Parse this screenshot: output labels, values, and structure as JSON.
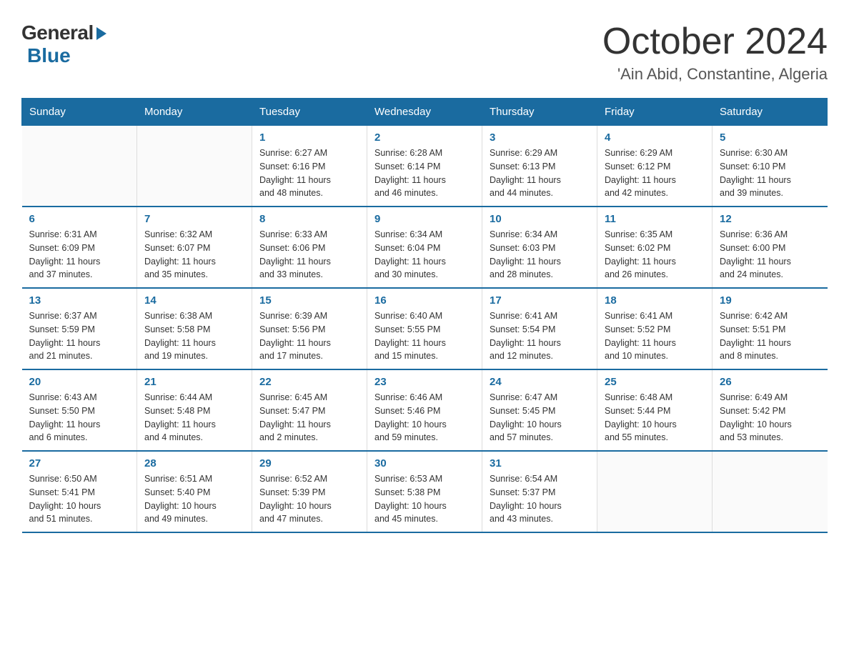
{
  "logo": {
    "general": "General",
    "blue": "Blue"
  },
  "title": "October 2024",
  "location": "'Ain Abid, Constantine, Algeria",
  "weekdays": [
    "Sunday",
    "Monday",
    "Tuesday",
    "Wednesday",
    "Thursday",
    "Friday",
    "Saturday"
  ],
  "weeks": [
    [
      {
        "day": "",
        "info": ""
      },
      {
        "day": "",
        "info": ""
      },
      {
        "day": "1",
        "info": "Sunrise: 6:27 AM\nSunset: 6:16 PM\nDaylight: 11 hours\nand 48 minutes."
      },
      {
        "day": "2",
        "info": "Sunrise: 6:28 AM\nSunset: 6:14 PM\nDaylight: 11 hours\nand 46 minutes."
      },
      {
        "day": "3",
        "info": "Sunrise: 6:29 AM\nSunset: 6:13 PM\nDaylight: 11 hours\nand 44 minutes."
      },
      {
        "day": "4",
        "info": "Sunrise: 6:29 AM\nSunset: 6:12 PM\nDaylight: 11 hours\nand 42 minutes."
      },
      {
        "day": "5",
        "info": "Sunrise: 6:30 AM\nSunset: 6:10 PM\nDaylight: 11 hours\nand 39 minutes."
      }
    ],
    [
      {
        "day": "6",
        "info": "Sunrise: 6:31 AM\nSunset: 6:09 PM\nDaylight: 11 hours\nand 37 minutes."
      },
      {
        "day": "7",
        "info": "Sunrise: 6:32 AM\nSunset: 6:07 PM\nDaylight: 11 hours\nand 35 minutes."
      },
      {
        "day": "8",
        "info": "Sunrise: 6:33 AM\nSunset: 6:06 PM\nDaylight: 11 hours\nand 33 minutes."
      },
      {
        "day": "9",
        "info": "Sunrise: 6:34 AM\nSunset: 6:04 PM\nDaylight: 11 hours\nand 30 minutes."
      },
      {
        "day": "10",
        "info": "Sunrise: 6:34 AM\nSunset: 6:03 PM\nDaylight: 11 hours\nand 28 minutes."
      },
      {
        "day": "11",
        "info": "Sunrise: 6:35 AM\nSunset: 6:02 PM\nDaylight: 11 hours\nand 26 minutes."
      },
      {
        "day": "12",
        "info": "Sunrise: 6:36 AM\nSunset: 6:00 PM\nDaylight: 11 hours\nand 24 minutes."
      }
    ],
    [
      {
        "day": "13",
        "info": "Sunrise: 6:37 AM\nSunset: 5:59 PM\nDaylight: 11 hours\nand 21 minutes."
      },
      {
        "day": "14",
        "info": "Sunrise: 6:38 AM\nSunset: 5:58 PM\nDaylight: 11 hours\nand 19 minutes."
      },
      {
        "day": "15",
        "info": "Sunrise: 6:39 AM\nSunset: 5:56 PM\nDaylight: 11 hours\nand 17 minutes."
      },
      {
        "day": "16",
        "info": "Sunrise: 6:40 AM\nSunset: 5:55 PM\nDaylight: 11 hours\nand 15 minutes."
      },
      {
        "day": "17",
        "info": "Sunrise: 6:41 AM\nSunset: 5:54 PM\nDaylight: 11 hours\nand 12 minutes."
      },
      {
        "day": "18",
        "info": "Sunrise: 6:41 AM\nSunset: 5:52 PM\nDaylight: 11 hours\nand 10 minutes."
      },
      {
        "day": "19",
        "info": "Sunrise: 6:42 AM\nSunset: 5:51 PM\nDaylight: 11 hours\nand 8 minutes."
      }
    ],
    [
      {
        "day": "20",
        "info": "Sunrise: 6:43 AM\nSunset: 5:50 PM\nDaylight: 11 hours\nand 6 minutes."
      },
      {
        "day": "21",
        "info": "Sunrise: 6:44 AM\nSunset: 5:48 PM\nDaylight: 11 hours\nand 4 minutes."
      },
      {
        "day": "22",
        "info": "Sunrise: 6:45 AM\nSunset: 5:47 PM\nDaylight: 11 hours\nand 2 minutes."
      },
      {
        "day": "23",
        "info": "Sunrise: 6:46 AM\nSunset: 5:46 PM\nDaylight: 10 hours\nand 59 minutes."
      },
      {
        "day": "24",
        "info": "Sunrise: 6:47 AM\nSunset: 5:45 PM\nDaylight: 10 hours\nand 57 minutes."
      },
      {
        "day": "25",
        "info": "Sunrise: 6:48 AM\nSunset: 5:44 PM\nDaylight: 10 hours\nand 55 minutes."
      },
      {
        "day": "26",
        "info": "Sunrise: 6:49 AM\nSunset: 5:42 PM\nDaylight: 10 hours\nand 53 minutes."
      }
    ],
    [
      {
        "day": "27",
        "info": "Sunrise: 6:50 AM\nSunset: 5:41 PM\nDaylight: 10 hours\nand 51 minutes."
      },
      {
        "day": "28",
        "info": "Sunrise: 6:51 AM\nSunset: 5:40 PM\nDaylight: 10 hours\nand 49 minutes."
      },
      {
        "day": "29",
        "info": "Sunrise: 6:52 AM\nSunset: 5:39 PM\nDaylight: 10 hours\nand 47 minutes."
      },
      {
        "day": "30",
        "info": "Sunrise: 6:53 AM\nSunset: 5:38 PM\nDaylight: 10 hours\nand 45 minutes."
      },
      {
        "day": "31",
        "info": "Sunrise: 6:54 AM\nSunset: 5:37 PM\nDaylight: 10 hours\nand 43 minutes."
      },
      {
        "day": "",
        "info": ""
      },
      {
        "day": "",
        "info": ""
      }
    ]
  ]
}
